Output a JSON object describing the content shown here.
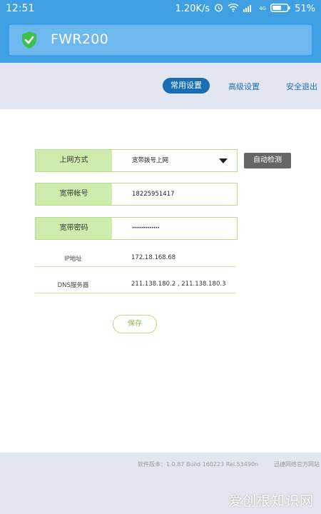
{
  "status_bar": {
    "time": "12:51",
    "speed": "1.20K/s",
    "network": "4G",
    "battery": "51%",
    "icons": [
      "alarm-icon",
      "wifi-icon",
      "signal-icon",
      "battery-icon"
    ]
  },
  "header": {
    "title": "FWR200",
    "icon": "shield-check-icon",
    "bg_color": "#3f9fe3",
    "card_color": "#6fb7ef"
  },
  "nav": {
    "tabs": [
      {
        "label": "常用设置",
        "active": true
      },
      {
        "label": "高级设置",
        "active": false
      },
      {
        "label": "安全退出",
        "active": false
      }
    ],
    "active_color": "#176eb5"
  },
  "form": {
    "connection_type": {
      "label": "上网方式",
      "value": "宽带拨号上网"
    },
    "detect_button": "自动检测",
    "account": {
      "label": "宽带帐号",
      "value": "18225951417"
    },
    "password": {
      "label": "宽带密码",
      "value": "··············"
    },
    "ip": {
      "label": "IP地址",
      "value": "172.18.168.68"
    },
    "dns": {
      "label": "DNS服务器",
      "value": "211.138.180.2 , 211.138.180.3"
    },
    "save_button": "保存",
    "label_bg_color": "#cdebad",
    "border_color": "#b9dc86"
  },
  "footer": {
    "version": "软件版本：1.0.87 Build 160223 Rel.53490n",
    "link": "迅捷网络官方网站"
  },
  "watermark": "爱创根知识网"
}
